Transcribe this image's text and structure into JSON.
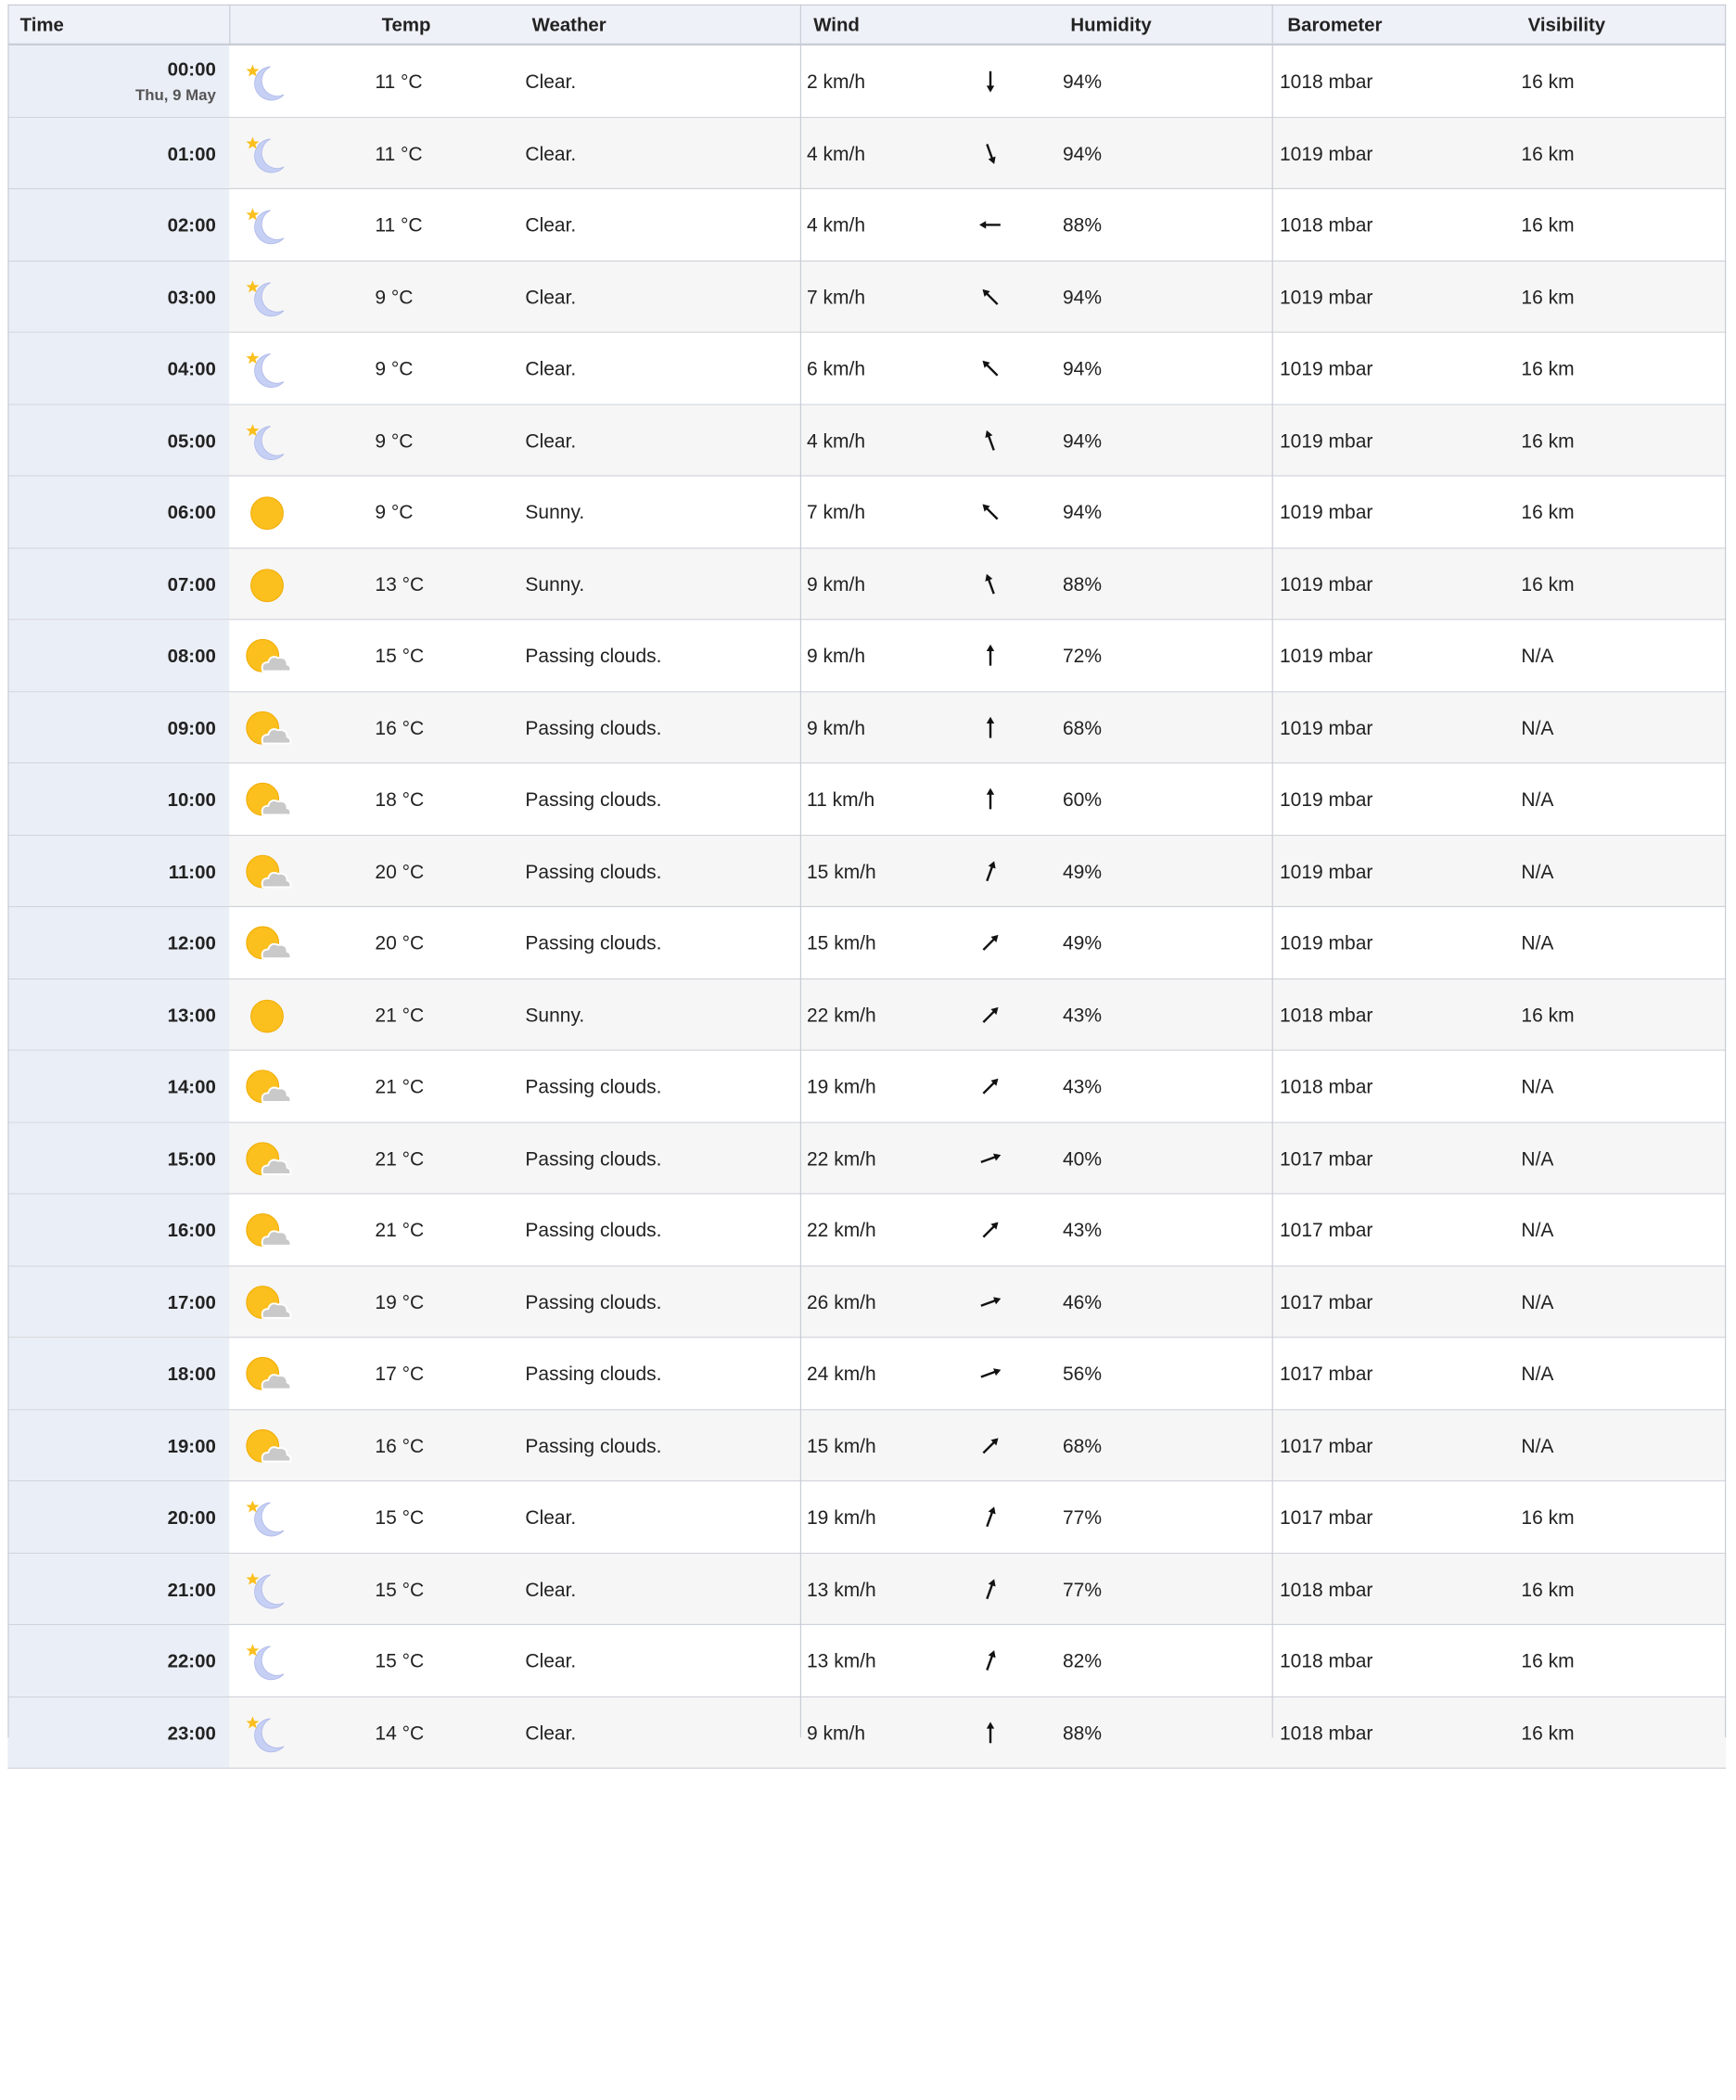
{
  "headers": {
    "time": "Time",
    "temp": "Temp",
    "weather": "Weather",
    "wind": "Wind",
    "humidity": "Humidity",
    "barometer": "Barometer",
    "visibility": "Visibility"
  },
  "colors": {
    "sun": "#fbbf1e",
    "moon": "#c6d0f5",
    "cloud": "#c9c9c9",
    "header_bg": "#eef1f7",
    "time_col_bg": "#eaeef6"
  },
  "rows": [
    {
      "time": "00:00",
      "date": "Thu, 9 May",
      "icon": "clear-night-icon",
      "temp": "11 °C",
      "weather": "Clear.",
      "wind": "2 km/h",
      "wind_dir_deg": 180,
      "humidity": "94%",
      "barometer": "1018 mbar",
      "visibility": "16 km"
    },
    {
      "time": "01:00",
      "icon": "clear-night-icon",
      "temp": "11 °C",
      "weather": "Clear.",
      "wind": "4 km/h",
      "wind_dir_deg": 160,
      "humidity": "94%",
      "barometer": "1019 mbar",
      "visibility": "16 km"
    },
    {
      "time": "02:00",
      "icon": "clear-night-icon",
      "temp": "11 °C",
      "weather": "Clear.",
      "wind": "4 km/h",
      "wind_dir_deg": 270,
      "humidity": "88%",
      "barometer": "1018 mbar",
      "visibility": "16 km"
    },
    {
      "time": "03:00",
      "icon": "clear-night-icon",
      "temp": "9 °C",
      "weather": "Clear.",
      "wind": "7 km/h",
      "wind_dir_deg": 315,
      "humidity": "94%",
      "barometer": "1019 mbar",
      "visibility": "16 km"
    },
    {
      "time": "04:00",
      "icon": "clear-night-icon",
      "temp": "9 °C",
      "weather": "Clear.",
      "wind": "6 km/h",
      "wind_dir_deg": 315,
      "humidity": "94%",
      "barometer": "1019 mbar",
      "visibility": "16 km"
    },
    {
      "time": "05:00",
      "icon": "clear-night-icon",
      "temp": "9 °C",
      "weather": "Clear.",
      "wind": "4 km/h",
      "wind_dir_deg": 340,
      "humidity": "94%",
      "barometer": "1019 mbar",
      "visibility": "16 km"
    },
    {
      "time": "06:00",
      "icon": "sunny-icon",
      "temp": "9 °C",
      "weather": "Sunny.",
      "wind": "7 km/h",
      "wind_dir_deg": 315,
      "humidity": "94%",
      "barometer": "1019 mbar",
      "visibility": "16 km"
    },
    {
      "time": "07:00",
      "icon": "sunny-icon",
      "temp": "13 °C",
      "weather": "Sunny.",
      "wind": "9 km/h",
      "wind_dir_deg": 340,
      "humidity": "88%",
      "barometer": "1019 mbar",
      "visibility": "16 km"
    },
    {
      "time": "08:00",
      "icon": "passing-clouds-icon",
      "temp": "15 °C",
      "weather": "Passing clouds.",
      "wind": "9 km/h",
      "wind_dir_deg": 0,
      "humidity": "72%",
      "barometer": "1019 mbar",
      "visibility": "N/A"
    },
    {
      "time": "09:00",
      "icon": "passing-clouds-icon",
      "temp": "16 °C",
      "weather": "Passing clouds.",
      "wind": "9 km/h",
      "wind_dir_deg": 0,
      "humidity": "68%",
      "barometer": "1019 mbar",
      "visibility": "N/A"
    },
    {
      "time": "10:00",
      "icon": "passing-clouds-icon",
      "temp": "18 °C",
      "weather": "Passing clouds.",
      "wind": "11 km/h",
      "wind_dir_deg": 0,
      "humidity": "60%",
      "barometer": "1019 mbar",
      "visibility": "N/A"
    },
    {
      "time": "11:00",
      "icon": "passing-clouds-icon",
      "temp": "20 °C",
      "weather": "Passing clouds.",
      "wind": "15 km/h",
      "wind_dir_deg": 20,
      "humidity": "49%",
      "barometer": "1019 mbar",
      "visibility": "N/A"
    },
    {
      "time": "12:00",
      "icon": "passing-clouds-icon",
      "temp": "20 °C",
      "weather": "Passing clouds.",
      "wind": "15 km/h",
      "wind_dir_deg": 45,
      "humidity": "49%",
      "barometer": "1019 mbar",
      "visibility": "N/A"
    },
    {
      "time": "13:00",
      "icon": "sunny-icon",
      "temp": "21 °C",
      "weather": "Sunny.",
      "wind": "22 km/h",
      "wind_dir_deg": 45,
      "humidity": "43%",
      "barometer": "1018 mbar",
      "visibility": "16 km"
    },
    {
      "time": "14:00",
      "icon": "passing-clouds-icon",
      "temp": "21 °C",
      "weather": "Passing clouds.",
      "wind": "19 km/h",
      "wind_dir_deg": 45,
      "humidity": "43%",
      "barometer": "1018 mbar",
      "visibility": "N/A"
    },
    {
      "time": "15:00",
      "icon": "passing-clouds-icon",
      "temp": "21 °C",
      "weather": "Passing clouds.",
      "wind": "22 km/h",
      "wind_dir_deg": 70,
      "humidity": "40%",
      "barometer": "1017 mbar",
      "visibility": "N/A"
    },
    {
      "time": "16:00",
      "icon": "passing-clouds-icon",
      "temp": "21 °C",
      "weather": "Passing clouds.",
      "wind": "22 km/h",
      "wind_dir_deg": 45,
      "humidity": "43%",
      "barometer": "1017 mbar",
      "visibility": "N/A"
    },
    {
      "time": "17:00",
      "icon": "passing-clouds-icon",
      "temp": "19 °C",
      "weather": "Passing clouds.",
      "wind": "26 km/h",
      "wind_dir_deg": 70,
      "humidity": "46%",
      "barometer": "1017 mbar",
      "visibility": "N/A"
    },
    {
      "time": "18:00",
      "icon": "passing-clouds-icon",
      "temp": "17 °C",
      "weather": "Passing clouds.",
      "wind": "24 km/h",
      "wind_dir_deg": 70,
      "humidity": "56%",
      "barometer": "1017 mbar",
      "visibility": "N/A"
    },
    {
      "time": "19:00",
      "icon": "passing-clouds-icon",
      "temp": "16 °C",
      "weather": "Passing clouds.",
      "wind": "15 km/h",
      "wind_dir_deg": 45,
      "humidity": "68%",
      "barometer": "1017 mbar",
      "visibility": "N/A"
    },
    {
      "time": "20:00",
      "icon": "clear-night-icon",
      "temp": "15 °C",
      "weather": "Clear.",
      "wind": "19 km/h",
      "wind_dir_deg": 20,
      "humidity": "77%",
      "barometer": "1017 mbar",
      "visibility": "16 km"
    },
    {
      "time": "21:00",
      "icon": "clear-night-icon",
      "temp": "15 °C",
      "weather": "Clear.",
      "wind": "13 km/h",
      "wind_dir_deg": 20,
      "humidity": "77%",
      "barometer": "1018 mbar",
      "visibility": "16 km"
    },
    {
      "time": "22:00",
      "icon": "clear-night-icon",
      "temp": "15 °C",
      "weather": "Clear.",
      "wind": "13 km/h",
      "wind_dir_deg": 20,
      "humidity": "82%",
      "barometer": "1018 mbar",
      "visibility": "16 km"
    },
    {
      "time": "23:00",
      "icon": "clear-night-icon",
      "temp": "14 °C",
      "weather": "Clear.",
      "wind": "9 km/h",
      "wind_dir_deg": 0,
      "humidity": "88%",
      "barometer": "1018 mbar",
      "visibility": "16 km"
    }
  ]
}
